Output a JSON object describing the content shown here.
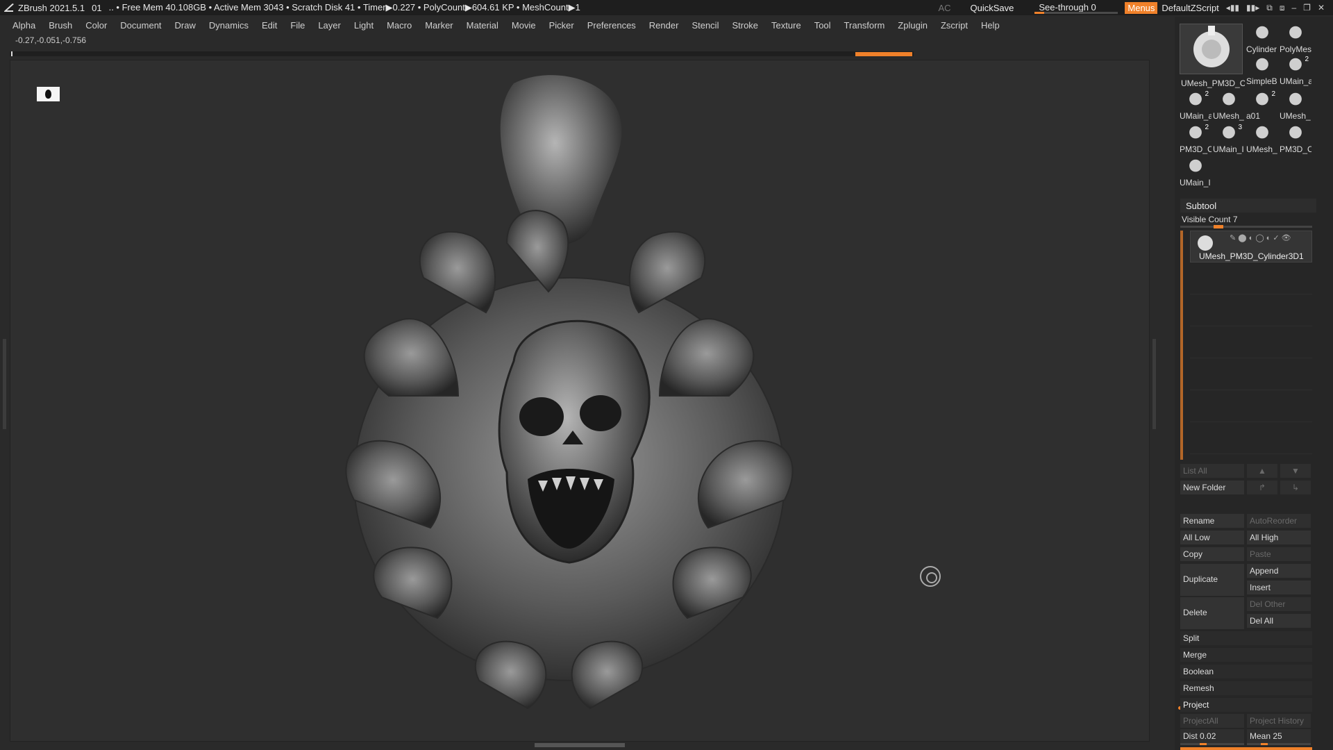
{
  "title": {
    "app": "ZBrush 2021.5.1",
    "doc": "01",
    "stats": ".. • Free Mem 40.108GB • Active Mem 3043 • Scratch Disk 41 •  Timer▶0.227 • PolyCount▶604.61 KP  • MeshCount▶1",
    "ac": "AC",
    "quicksave": "QuickSave",
    "seethrough": "See-through  0",
    "seethrough_value": 0,
    "menus": "Menus",
    "defaultzscript": "DefaultZScript"
  },
  "menu": [
    "Alpha",
    "Brush",
    "Color",
    "Document",
    "Draw",
    "Dynamics",
    "Edit",
    "File",
    "Layer",
    "Light",
    "Macro",
    "Marker",
    "Material",
    "Movie",
    "Picker",
    "Preferences",
    "Render",
    "Stencil",
    "Stroke",
    "Texture",
    "Tool",
    "Transform",
    "Zplugin",
    "Zscript",
    "Help"
  ],
  "coords": "-0.27,-0.051,-0.756",
  "tools": {
    "main_label": "UMesh_PM3D_C",
    "items": [
      {
        "label": "Cylinder",
        "badge": ""
      },
      {
        "label": "PolyMes",
        "badge": ""
      },
      {
        "label": "SimpleB",
        "badge": ""
      },
      {
        "label": "UMain_a",
        "badge": "2"
      },
      {
        "label": "UMain_a",
        "badge": "2"
      },
      {
        "label": "UMesh_",
        "badge": ""
      },
      {
        "label": "a01",
        "badge": "2"
      },
      {
        "label": "UMesh_",
        "badge": ""
      },
      {
        "label": "PM3D_C",
        "badge": "2"
      },
      {
        "label": "UMain_I",
        "badge": "3"
      },
      {
        "label": "UMesh_",
        "badge": ""
      },
      {
        "label": "PM3D_C",
        "badge": ""
      },
      {
        "label": "UMain_I",
        "badge": ""
      }
    ]
  },
  "subtool": {
    "title": "Subtool",
    "visible_count": "Visible Count 7",
    "item_name": "UMesh_PM3D_Cylinder3D1",
    "list_all": "List All",
    "new_folder": "New Folder",
    "rename": "Rename",
    "autoreorder": "AutoReorder",
    "all_low": "All Low",
    "all_high": "All High",
    "copy": "Copy",
    "paste": "Paste",
    "duplicate": "Duplicate",
    "append": "Append",
    "insert": "Insert",
    "delete": "Delete",
    "del_other": "Del Other",
    "del_all": "Del All",
    "split": "Split",
    "merge": "Merge",
    "boolean": "Boolean",
    "remesh": "Remesh",
    "project": "Project",
    "projectall": "ProjectAll",
    "project_history": "Project History",
    "dist_label": "Dist",
    "dist_value": "0.02",
    "mean_label": "Mean",
    "mean_value": "25"
  },
  "colors": {
    "accent": "#f0812a",
    "bg": "#2a2a2a",
    "panel": "#262626"
  }
}
